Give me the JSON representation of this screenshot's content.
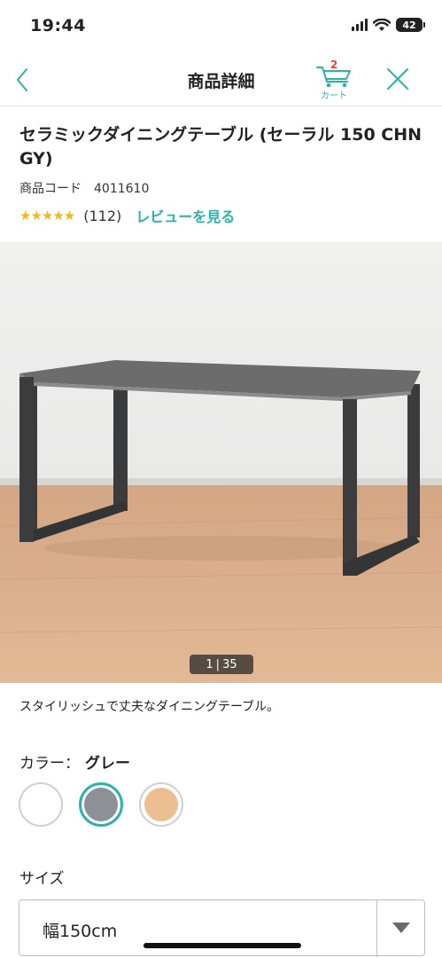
{
  "status_bar": {
    "time": "19:44",
    "battery": "42"
  },
  "nav": {
    "title": "商品詳細",
    "cart_count": "2",
    "cart_label": "カート"
  },
  "product": {
    "title": "セラミックダイニングテーブル (セーラル 150 CHN GY)",
    "code_label": "商品コード",
    "code": "4011610",
    "stars": "★★★★★",
    "review_count": "(112)",
    "review_link": "レビューを見る"
  },
  "image": {
    "current": "1",
    "total": "35",
    "separator": "|"
  },
  "description": "スタイリッシュで丈夫なダイニングテーブル。",
  "color": {
    "label": "カラー：",
    "selected": "グレー",
    "options": [
      {
        "name": "white",
        "hex": "#ffffff"
      },
      {
        "name": "gray",
        "hex": "#8b9196"
      },
      {
        "name": "beige",
        "hex": "#ecbf91"
      }
    ]
  },
  "size": {
    "label": "サイズ",
    "value": "幅150cm"
  },
  "colors": {
    "accent": "#2cb3a8",
    "badge": "#e04b3a",
    "star": "#f4b81c"
  }
}
